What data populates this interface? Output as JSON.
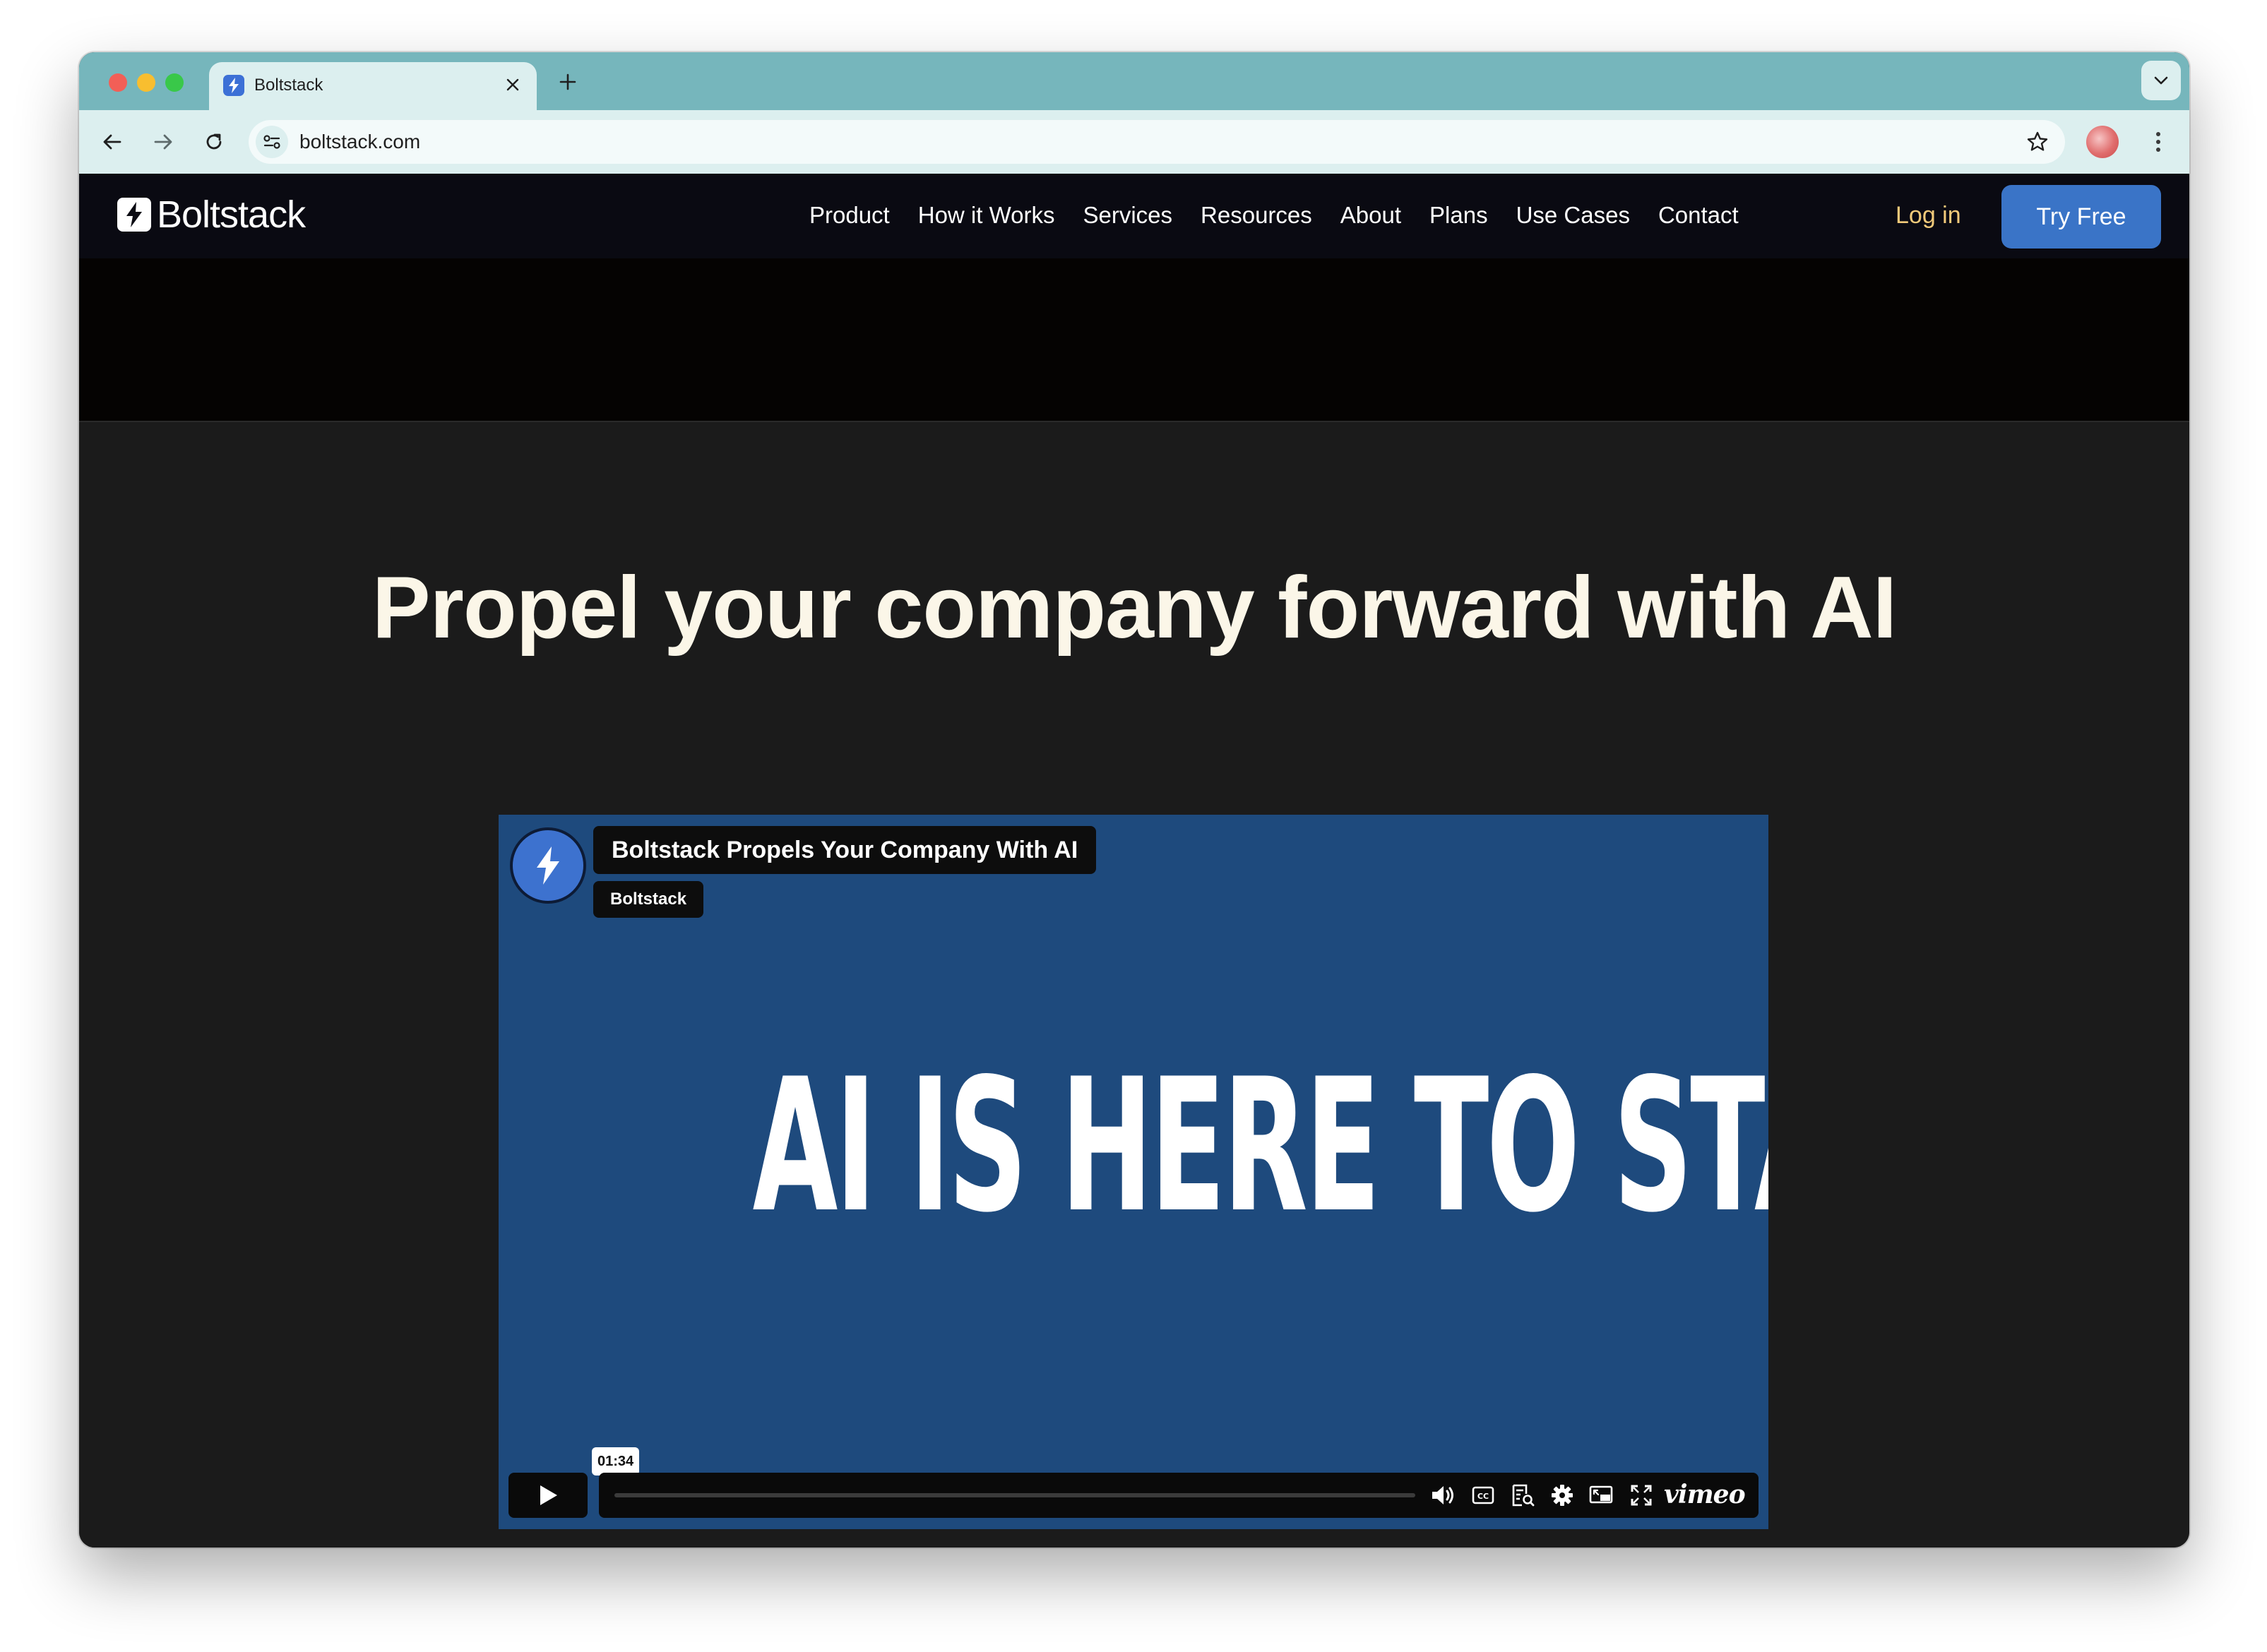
{
  "browser": {
    "tab": {
      "title": "Boltstack",
      "favicon": "bolt-icon"
    },
    "url": "boltstack.com"
  },
  "site": {
    "brand": "Boltstack",
    "nav": [
      "Product",
      "How it Works",
      "Services",
      "Resources",
      "About",
      "Plans",
      "Use Cases",
      "Contact"
    ],
    "login": "Log in",
    "cta": "Try Free"
  },
  "hero": {
    "headline": "Propel your company forward with AI"
  },
  "video": {
    "title": "Boltstack Propels Your Company With AI",
    "channel": "Boltstack",
    "frame_text": "AI IS HERE TO STAY",
    "time": "01:34",
    "provider": "vimeo"
  },
  "colors": {
    "accent": "#3a74c7",
    "video_bg": "#1e4a7d",
    "login": "#f2ca7a",
    "tab_strip": "#76b6bc"
  }
}
